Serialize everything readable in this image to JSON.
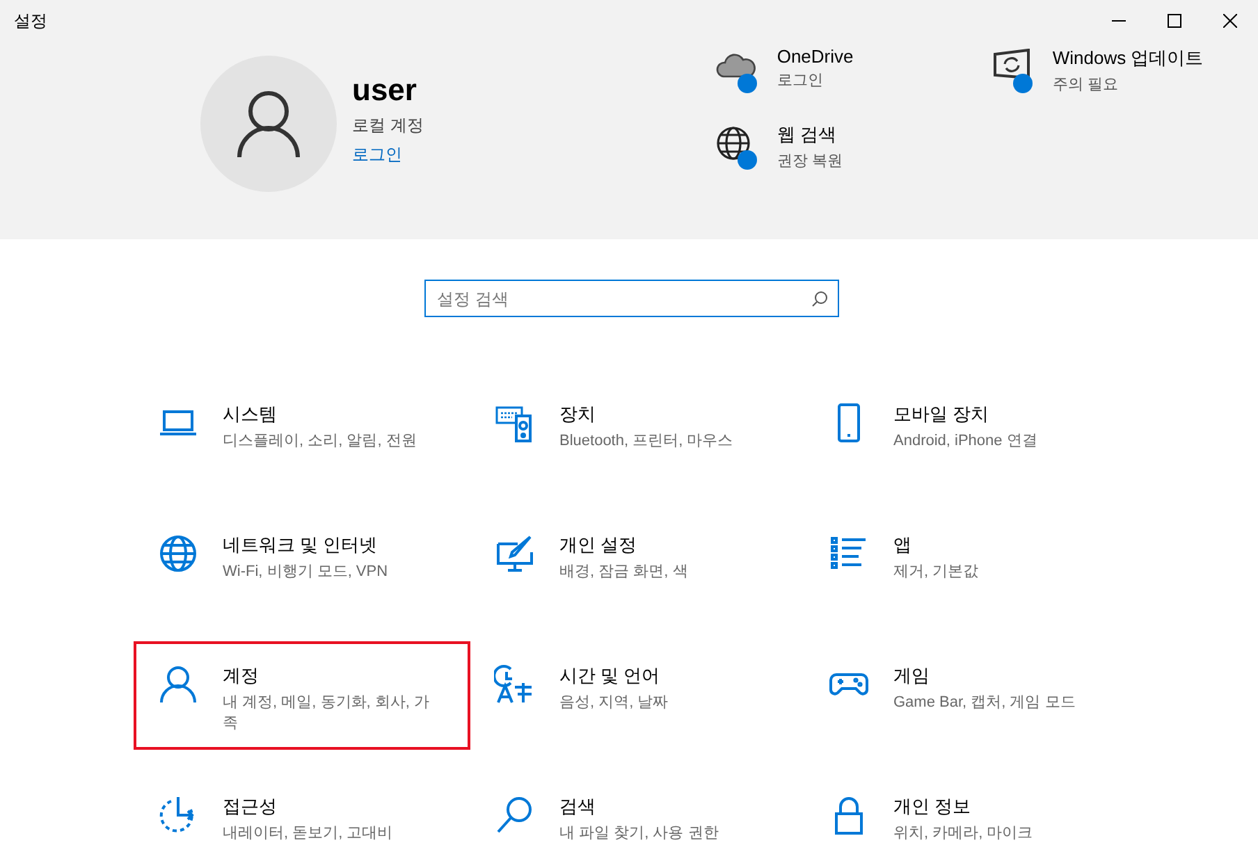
{
  "window": {
    "title": "설정"
  },
  "account": {
    "name": "user",
    "type": "로컬 계정",
    "link": "로그인"
  },
  "status_items": [
    {
      "kind": "cloud",
      "title": "OneDrive",
      "subtitle": "로그인",
      "badge": true
    },
    {
      "kind": "update",
      "title": "Windows 업데이트",
      "subtitle": "주의 필요",
      "badge": true
    },
    {
      "kind": "globe",
      "title": "웹 검색",
      "subtitle": "권장 복원",
      "badge": true
    }
  ],
  "search": {
    "placeholder": "설정 검색"
  },
  "categories": [
    {
      "kind": "laptop",
      "title": "시스템",
      "description": "디스플레이, 소리, 알림, 전원",
      "highlighted": false
    },
    {
      "kind": "devices",
      "title": "장치",
      "description": "Bluetooth, 프린터, 마우스",
      "highlighted": false
    },
    {
      "kind": "phone",
      "title": "모바일 장치",
      "description": "Android, iPhone 연결",
      "highlighted": false
    },
    {
      "kind": "globe",
      "title": "네트워크 및 인터넷",
      "description": "Wi-Fi, 비행기 모드, VPN",
      "highlighted": false
    },
    {
      "kind": "personalize",
      "title": "개인 설정",
      "description": "배경, 잠금 화면, 색",
      "highlighted": false
    },
    {
      "kind": "apps",
      "title": "앱",
      "description": "제거, 기본값",
      "highlighted": false
    },
    {
      "kind": "person",
      "title": "계정",
      "description": "내 계정, 메일, 동기화, 회사, 가족",
      "highlighted": true
    },
    {
      "kind": "time",
      "title": "시간 및 언어",
      "description": "음성, 지역, 날짜",
      "highlighted": false
    },
    {
      "kind": "gamepad",
      "title": "게임",
      "description": "Game Bar, 캡처, 게임 모드",
      "highlighted": false
    },
    {
      "kind": "access",
      "title": "접근성",
      "description": "내레이터, 돋보기, 고대비",
      "highlighted": false
    },
    {
      "kind": "search",
      "title": "검색",
      "description": "내 파일 찾기, 사용 권한",
      "highlighted": false
    },
    {
      "kind": "lock",
      "title": "개인 정보",
      "description": "위치, 카메라, 마이크",
      "highlighted": false
    }
  ]
}
